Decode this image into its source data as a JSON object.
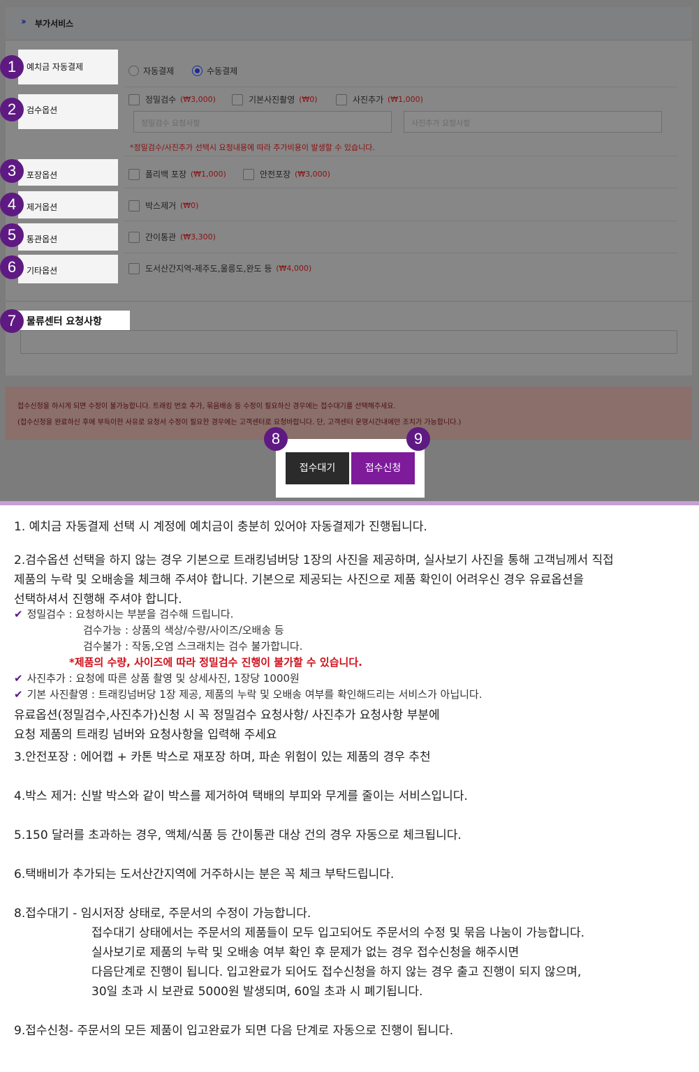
{
  "panel": {
    "header_icon": "double-chevron-right-icon",
    "title": "부가서비스"
  },
  "badges": [
    "1",
    "2",
    "3",
    "4",
    "5",
    "6",
    "7",
    "8",
    "9"
  ],
  "rows": {
    "autopay": {
      "label": "예치금 자동결제",
      "options": [
        "자동결제",
        "수동결제"
      ],
      "selected": "수동결제"
    },
    "inspection": {
      "label": "검수옵션",
      "opt1": "정밀검수",
      "opt1_price": "(₩3,000)",
      "opt2": "기본사진촬영",
      "opt2_price": "(₩0)",
      "opt3": "사진추가",
      "opt3_price": "(₩1,000)",
      "input1_placeholder": "정밀검수 요청사항",
      "input2_placeholder": "사진추가 요청사항",
      "warning": "*정밀검수/사진추가 선택시 요청내용에 따라 추가비용이 발생할 수 있습니다."
    },
    "packing": {
      "label": "포장옵션",
      "opt1": "폴리백 포장",
      "opt1_price": "(₩1,000)",
      "opt2": "안전포장",
      "opt2_price": "(₩3,000)"
    },
    "removal": {
      "label": "제거옵션",
      "opt1": "박스제거",
      "opt1_price": "(₩0)"
    },
    "customs": {
      "label": "통관옵션",
      "opt1": "간이통관",
      "opt1_price": "(₩3,300)"
    },
    "etc": {
      "label": "기타옵션",
      "opt1": "도서산간지역-제주도,울릉도,완도 등",
      "opt1_price": "(₩4,000)"
    }
  },
  "request": {
    "label": "물류센터 요청사항"
  },
  "notice": {
    "line1": "접수신청을 하시게 되면 수정이 불가능합니다. 트래킹 번호 추가, 묶음배송 등 수정이 필요하신 경우에는 접수대기를 선택해주세요.",
    "line2": "(접수신청을 완료하신 후에 부득이한 사유로 요청서 수정이 필요한 경우에는 고객센터로 요청바랍니다. 단, 고객센터 운영시간내에만 조치가 가능합니다.)"
  },
  "buttons": {
    "wait": "접수대기",
    "apply": "접수신청"
  },
  "info": {
    "p1": "1. 예치금 자동결제 선택 시 계정에 예치금이 충분히 있어야 자동결제가 진행됩니다.",
    "p2_l1": "2.검수옵션 선택을 하지 않는 경우 기본으로 트래킹넘버당 1장의 사진을 제공하며, 실사보기 사진을 통해 고객님께서 직접",
    "p2_l2": "제품의 누락 및 오배송을 체크해 주셔야 합니다. 기본으로 제공되는 사진으로 제품 확인이 어려우신 경우 유료옵션을",
    "p2_l3": "선택하셔서 진행해 주셔야 합니다.",
    "check_icon": "checkmark-icon",
    "c1": "정밀검수 : 요청하시는 부분을 검수해 드립니다.",
    "c1_a": "검수가능 : 상품의 색상/수량/사이즈/오배송 등",
    "c1_b": "검수불가 : 작동,오염 스크래치는 검수 불가합니다.",
    "c1_red": "*제품의 수량, 사이즈에 따라 정밀검수 진행이 불가할 수 있습니다.",
    "c2": "사진추가 : 요청에 따른 상품 촬영 및 상세사진, 1장당 1000원",
    "c3": "기본 사진촬영 : 트래킹넘버당 1장 제공, 제품의 누락 및 오배송 여부를 확인해드리는 서비스가 아닙니다.",
    "p2_l4": "유료옵션(정밀검수,사진추가)신청 시 꼭 정밀검수 요청사항/ 사진추가 요청사항 부분에",
    "p2_l5": "요청 제품의 트래킹 넘버와 요청사항을 입력해 주세요",
    "p3": "3.안전포장 : 에어캡 + 카톤 박스로 재포장 하며, 파손 위험이 있는 제품의 경우 추천",
    "p4": "4.박스 제거: 신발 박스와 같이 박스를 제거하여 택배의 부피와 무게를 줄이는 서비스입니다.",
    "p5": "5.150 달러를 초과하는 경우, 액체/식품 등 간이통관 대상 건의 경우 자동으로 체크됩니다.",
    "p6": "6.택배비가 추가되는 도서산간지역에 거주하시는 분은 꼭 체크 부탁드립니다.",
    "p8_l1": "8.접수대기 - 임시저장 상태로, 주문서의 수정이 가능합니다.",
    "p8_l2": "접수대기 상태에서는 주문서의 제품들이 모두 입고되어도 주문서의 수정 및 묶음 나눔이 가능합니다.",
    "p8_l3": "실사보기로 제품의 누락 및 오배송 여부 확인 후 문제가 없는 경우 접수신청을 해주시면",
    "p8_l4": "다음단계로 진행이 됩니다. 입고완료가 되어도 접수신청을 하지 않는 경우 출고 진행이 되지 않으며,",
    "p8_l5": "30일 초과 시 보관료 5000원 발생되며, 60일 초과 시 폐기됩니다.",
    "p9": "9.접수신청- 주문서의 모든 제품이 입고완료가 되면 다음 단계로 자동으로 진행이 됩니다."
  }
}
